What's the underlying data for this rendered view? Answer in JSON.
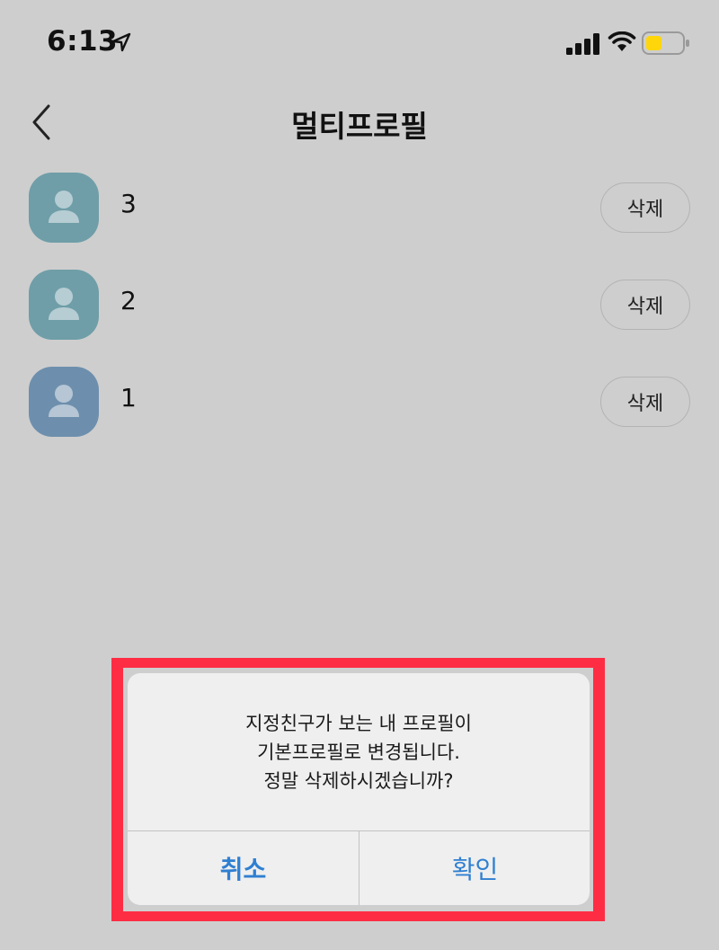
{
  "status_bar": {
    "time": "6:13",
    "icons": [
      "location-arrow-icon",
      "signal-icon",
      "wifi-icon",
      "battery-icon"
    ]
  },
  "nav": {
    "title": "멀티프로필",
    "back_icon": "chevron-left-icon"
  },
  "profiles": [
    {
      "name": "3",
      "avatar_color": "#6f9ea8",
      "delete_label": "삭제"
    },
    {
      "name": "2",
      "avatar_color": "#6f9ea8",
      "delete_label": "삭제"
    },
    {
      "name": "1",
      "avatar_color": "#6d8fad",
      "delete_label": "삭제"
    }
  ],
  "dialog": {
    "message_lines": [
      "지정친구가 보는 내 프로필이",
      "기본프로필로 변경됩니다.",
      "정말 삭제하시겠습니까?"
    ],
    "cancel_label": "취소",
    "confirm_label": "확인"
  },
  "colors": {
    "background": "#cecece",
    "dialog_background": "#efefef",
    "button_text": "#2f7fd1",
    "highlight": "#ff2d44",
    "battery_fill": "#ffd60a"
  }
}
